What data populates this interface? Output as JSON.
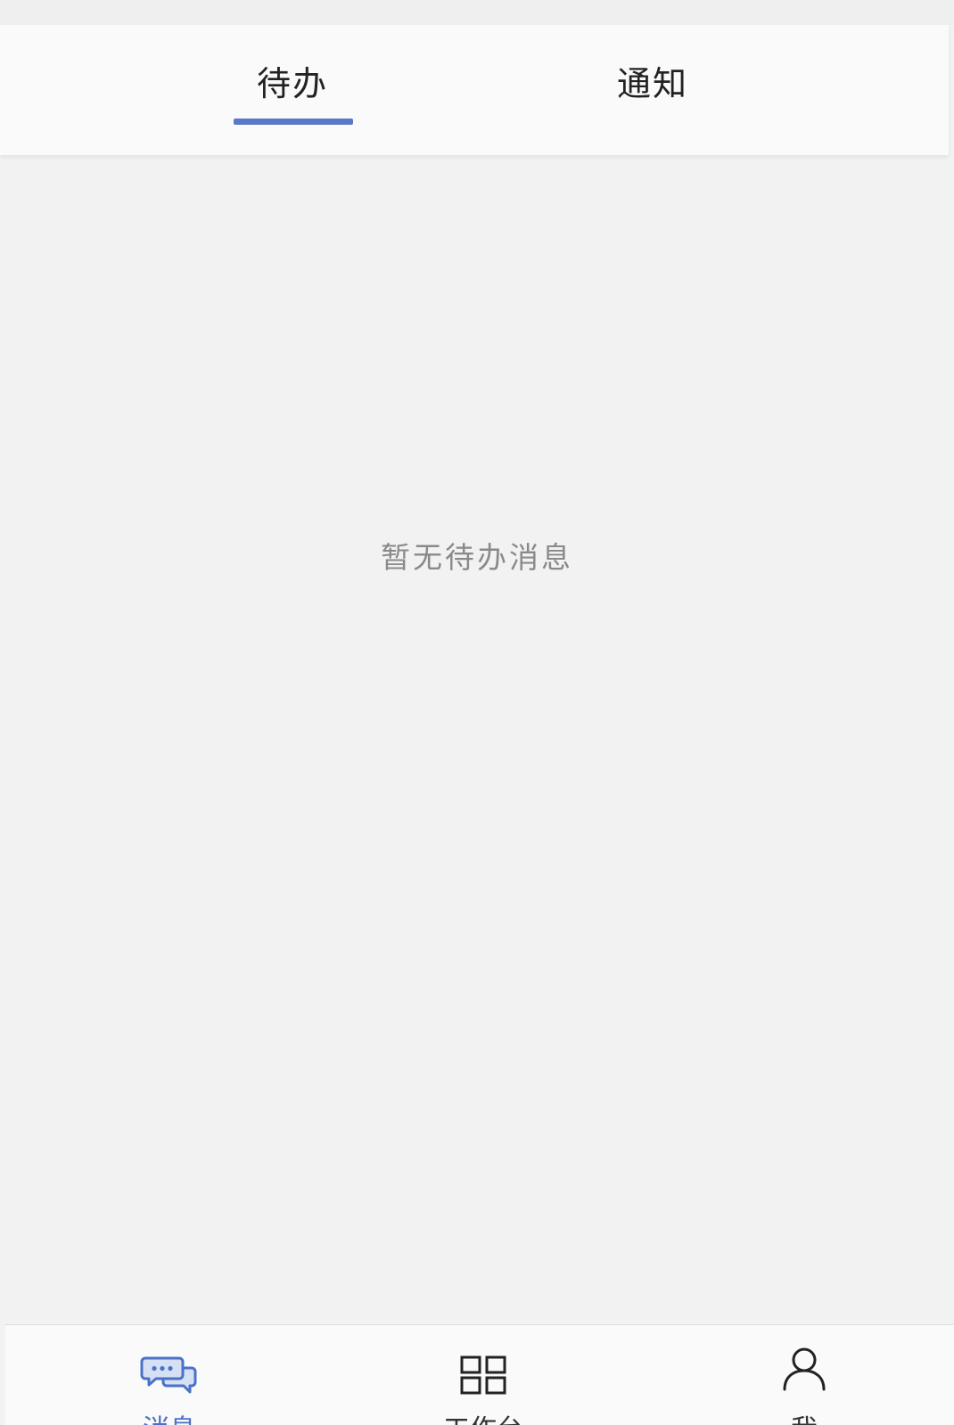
{
  "tabs": [
    {
      "label": "待办",
      "active": true
    },
    {
      "label": "通知",
      "active": false
    }
  ],
  "empty_state": {
    "message": "暂无待办消息"
  },
  "bottom_nav": {
    "items": [
      {
        "label": "消息",
        "icon": "chat-bubbles-icon",
        "active": true
      },
      {
        "label": "工作台",
        "icon": "grid-icon",
        "active": false
      },
      {
        "label": "我",
        "icon": "user-icon",
        "active": false
      }
    ]
  },
  "colors": {
    "accent": "#5b78c8",
    "background": "#f2f2f2",
    "bar_background": "#fafafa",
    "empty_text": "#8a8a8a"
  }
}
